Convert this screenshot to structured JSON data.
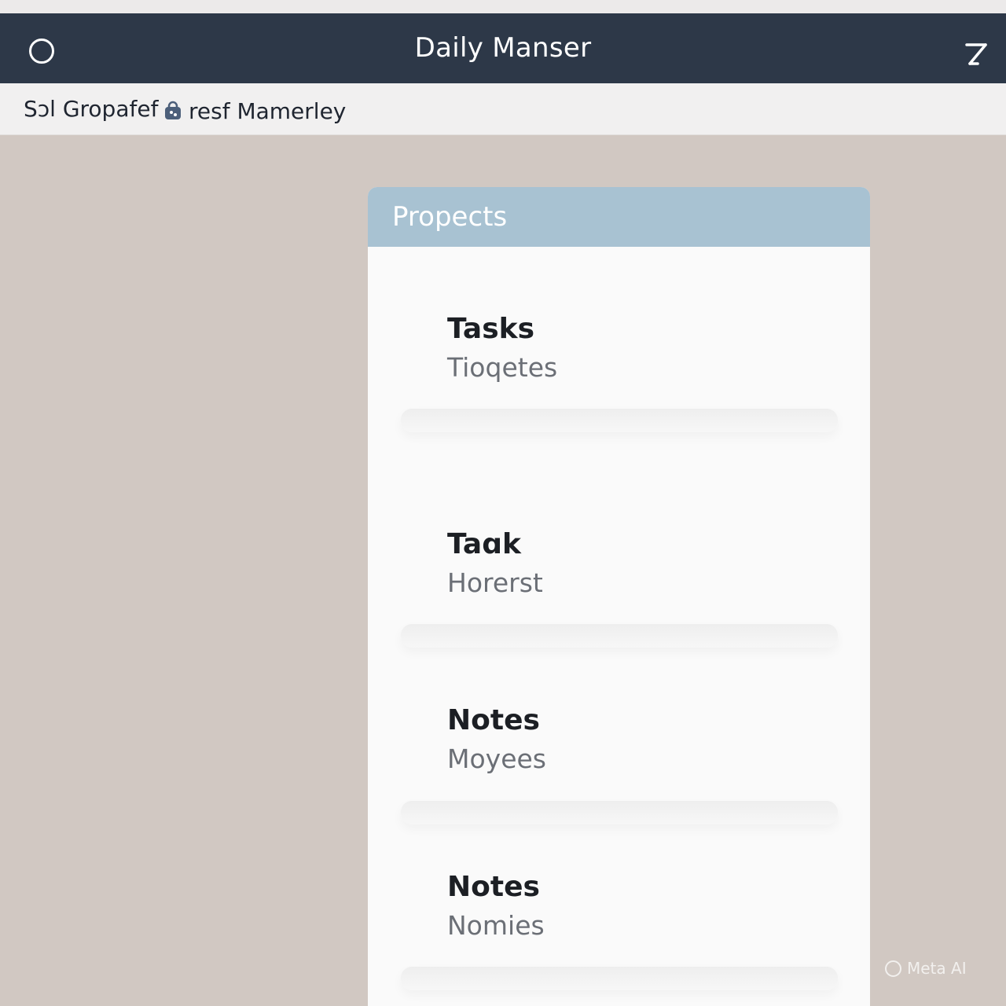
{
  "app": {
    "title": "Daily Manser"
  },
  "breadcrumb": {
    "item1": "Sɔl Gropafef",
    "item2": "resf Mamerley"
  },
  "panel": {
    "header": "Propects",
    "items": [
      {
        "title": "Tasks",
        "subtitle": "Tioqetes"
      },
      {
        "title": "Taɑk",
        "subtitle": "Horerst"
      },
      {
        "title": "Notes",
        "subtitle": "Moyees"
      },
      {
        "title": "Notes",
        "subtitle": "Nomies"
      }
    ]
  },
  "watermark": {
    "text": "Meta AI"
  },
  "colors": {
    "app_bar": "#2d3848",
    "panel_header": "#a8c2d2",
    "background": "#d1c8c2"
  },
  "icons": {
    "menu": "circle-icon",
    "edit": "pen-icon",
    "breadcrumb_tag": "tag-icon"
  }
}
